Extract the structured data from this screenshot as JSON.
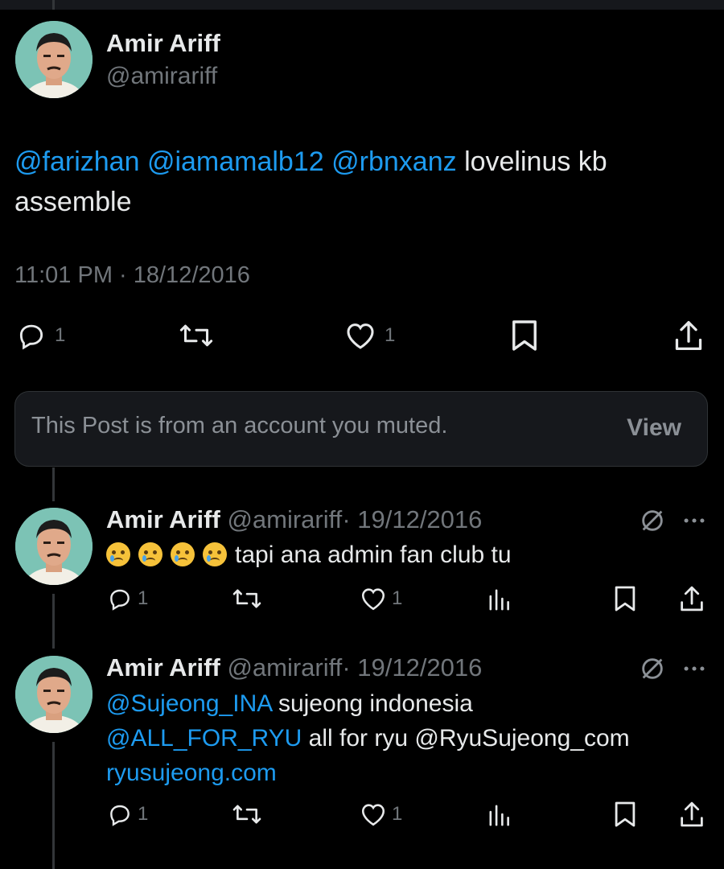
{
  "main_tweet": {
    "author_name": "Amir Ariff",
    "author_handle": "@amirariff",
    "mentions": [
      "@farizhan",
      "@iamamalb12",
      "@rbnxanz"
    ],
    "text_line1": "lovelinus kb",
    "text_line2": "assemble",
    "timestamp": "11:01 PM · 18/12/2016",
    "reply_count": "1",
    "like_count": "1"
  },
  "muted_notice": {
    "text": "This Post is from an account you muted.",
    "view_label": "View"
  },
  "replies": [
    {
      "author_name": "Amir Ariff",
      "author_handle": "@amirariff",
      "date": "· 19/12/2016",
      "emoji": "😢",
      "text": "tapi ana admin fan club tu",
      "reply_count": "1",
      "like_count": "1"
    },
    {
      "author_name": "Amir Ariff",
      "author_handle": "@amirariff",
      "date": "· 19/12/2016",
      "mention1": "@Sujeong_INA",
      "text1": "sujeong indonesia",
      "mention2": "@ALL_FOR_RYU",
      "text2": "all for ryu @RyuSujeong_com",
      "link": "ryusujeong.com",
      "reply_count": "1",
      "like_count": "1"
    }
  ],
  "icons": {
    "reply": "speech-bubble-icon",
    "repost": "repost-arrows-icon",
    "like": "heart-icon",
    "views": "bar-chart-icon",
    "bookmark": "bookmark-icon",
    "share": "share-icon",
    "muted": "slashed-circle-icon",
    "more": "ellipsis-icon"
  },
  "colors": {
    "background": "#000000",
    "text": "#e7e9ea",
    "secondary": "#71767b",
    "link": "#1d9bf0"
  }
}
